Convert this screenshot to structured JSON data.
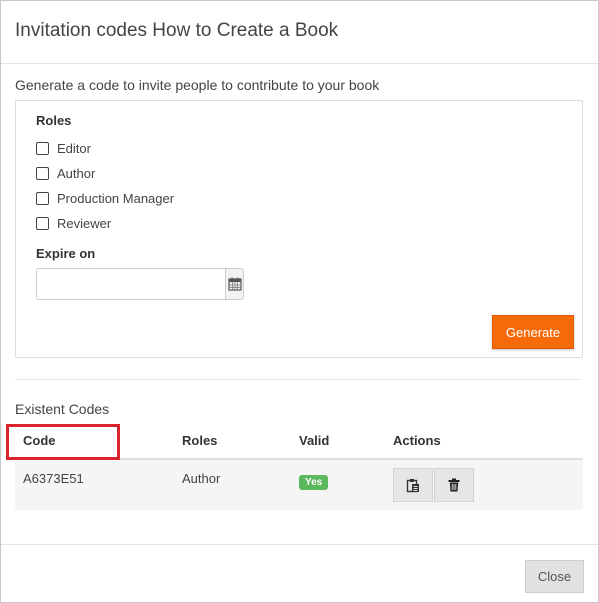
{
  "dialog": {
    "title": "Invitation codes How to Create a Book",
    "intro": "Generate a code to invite people to contribute to your book"
  },
  "form": {
    "roles_label": "Roles",
    "roles": [
      {
        "label": "Editor",
        "checked": false
      },
      {
        "label": "Author",
        "checked": false
      },
      {
        "label": "Production Manager",
        "checked": false
      },
      {
        "label": "Reviewer",
        "checked": false
      }
    ],
    "expire_label": "Expire on",
    "expire_value": "",
    "generate_label": "Generate"
  },
  "codes": {
    "section_label": "Existent Codes",
    "headers": {
      "code": "Code",
      "roles": "Roles",
      "valid": "Valid",
      "actions": "Actions"
    },
    "rows": [
      {
        "code": "A6373E51",
        "roles": "Author",
        "valid": "Yes"
      }
    ]
  },
  "footer": {
    "close_label": "Close"
  },
  "colors": {
    "generate_button": "#f76a0a",
    "valid_badge": "#5cb85c",
    "highlight_box": "#d9232d"
  },
  "icons": [
    "calendar-icon",
    "clipboard-icon",
    "trash-icon"
  ]
}
